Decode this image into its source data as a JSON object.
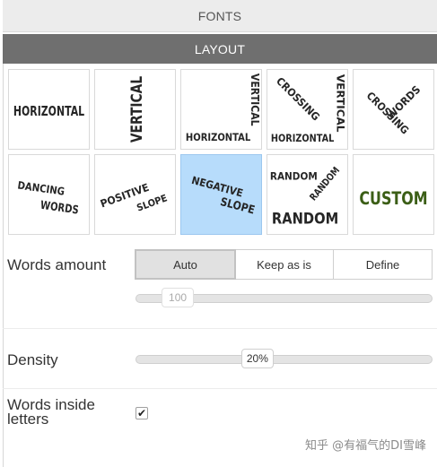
{
  "tabs": {
    "fonts": "FONTS",
    "layout": "LAYOUT"
  },
  "tiles": [
    {
      "id": "horizontal",
      "words": [
        "HORIZONTAL"
      ],
      "selected": false
    },
    {
      "id": "vertical",
      "words": [
        "VERTICAL"
      ],
      "selected": false
    },
    {
      "id": "horizontal-vertical",
      "words": [
        "VERTICAL",
        "HORIZONTAL"
      ],
      "selected": false
    },
    {
      "id": "crossing-vertical-horizontal",
      "words": [
        "CROSSING",
        "VERTICAL",
        "HORIZONTAL"
      ],
      "selected": false
    },
    {
      "id": "crossing-words",
      "words": [
        "CROSSING",
        "WORDS"
      ],
      "selected": false
    },
    {
      "id": "dancing-words",
      "words": [
        "DANCING",
        "WORDS"
      ],
      "selected": false
    },
    {
      "id": "positive-slope",
      "words": [
        "POSITIVE",
        "SLOPE"
      ],
      "selected": false
    },
    {
      "id": "negative-slope",
      "words": [
        "NEGATIVE",
        "SLOPE"
      ],
      "selected": true
    },
    {
      "id": "random",
      "words": [
        "RANDOM",
        "RANDOM",
        "RANDOM"
      ],
      "selected": false
    },
    {
      "id": "custom",
      "words": [
        "CUSTOM"
      ],
      "selected": false,
      "color": "#3b5e16"
    }
  ],
  "words_amount": {
    "label": "Words amount",
    "options": [
      "Auto",
      "Keep as is",
      "Define"
    ],
    "active": "Auto",
    "slider_value": "100",
    "slider_fraction": 0.14
  },
  "density": {
    "label": "Density",
    "value": "20%",
    "slider_fraction": 0.41
  },
  "words_inside_letters": {
    "label": "Words inside letters",
    "checked": true,
    "check_glyph": "✔"
  },
  "watermark": "知乎 @有福气的DI雪峰"
}
